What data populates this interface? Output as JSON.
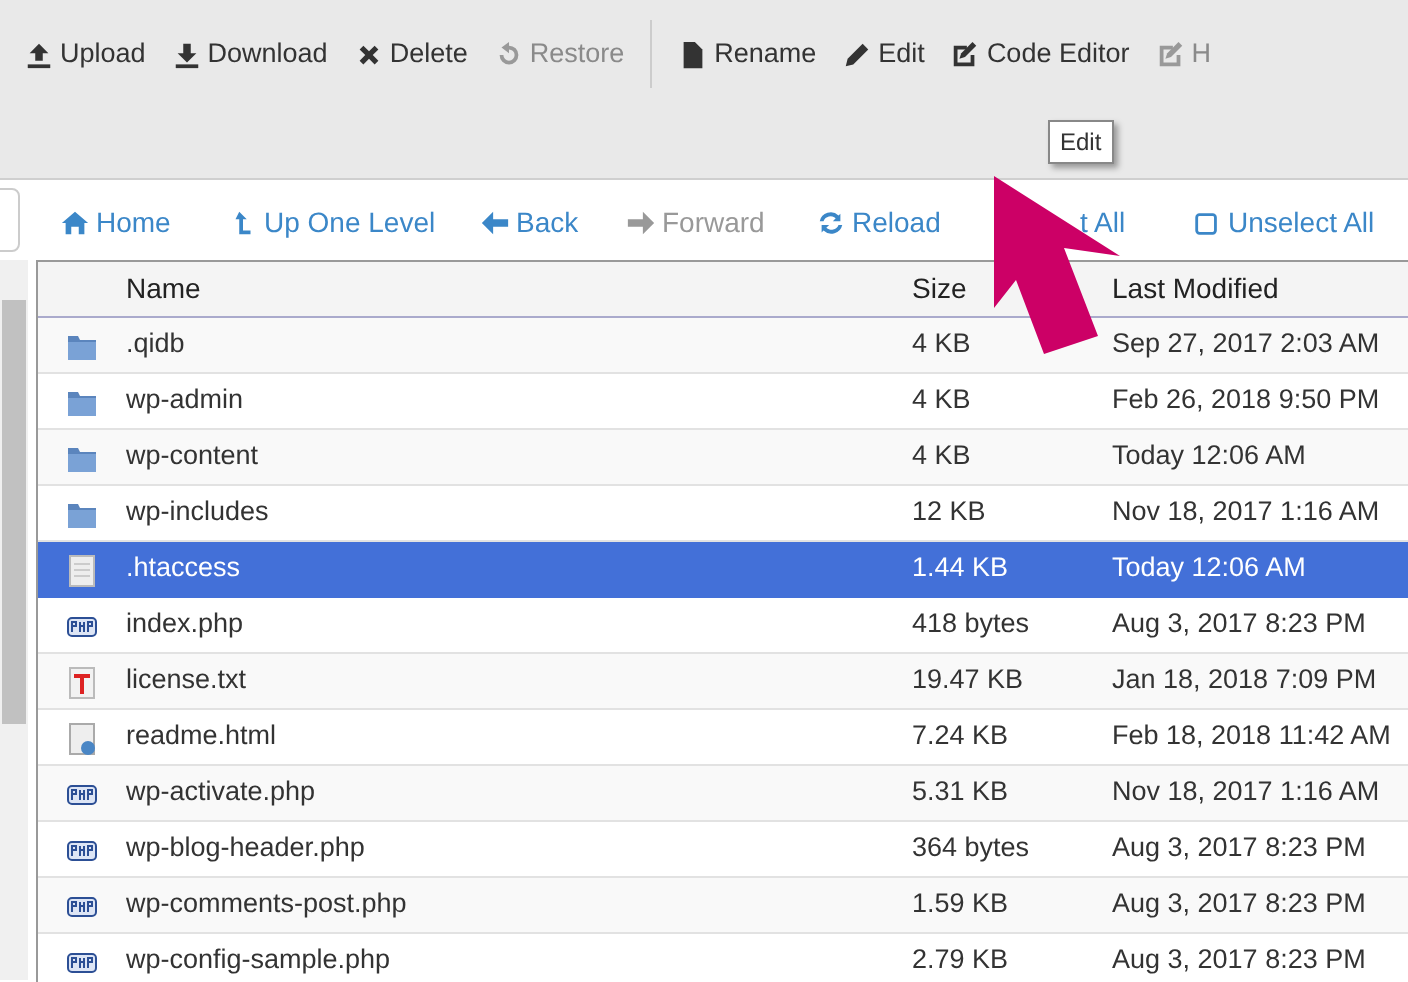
{
  "toolbar": [
    {
      "kind": "upload",
      "label": "Upload",
      "disabled": false
    },
    {
      "kind": "download",
      "label": "Download",
      "disabled": false
    },
    {
      "kind": "delete",
      "label": "Delete",
      "disabled": false
    },
    {
      "kind": "restore",
      "label": "Restore",
      "disabled": true
    },
    {
      "kind": "separator"
    },
    {
      "kind": "rename",
      "label": "Rename",
      "disabled": false
    },
    {
      "kind": "edit",
      "label": "Edit",
      "disabled": false
    },
    {
      "kind": "code",
      "label": "Code Editor",
      "disabled": false
    },
    {
      "kind": "code",
      "label": "H",
      "disabled": true
    }
  ],
  "tooltip": "Edit",
  "nav": [
    {
      "kind": "home",
      "label": "Home",
      "disabled": false
    },
    {
      "kind": "up",
      "label": "Up One Level",
      "disabled": false
    },
    {
      "kind": "back",
      "label": "Back",
      "disabled": false
    },
    {
      "kind": "forward",
      "label": "Forward",
      "disabled": true
    },
    {
      "kind": "reload",
      "label": "Reload",
      "disabled": false
    },
    {
      "kind": "none",
      "label": "t All",
      "disabled": false
    },
    {
      "kind": "square",
      "label": "Unselect All",
      "disabled": false
    }
  ],
  "table": {
    "columns": [
      "Name",
      "Size",
      "Last Modified"
    ],
    "rows": [
      {
        "kind": "folder",
        "name": ".qidb",
        "size": "4 KB",
        "modified": "Sep 27, 2017 2:03 AM",
        "selected": false
      },
      {
        "kind": "folder",
        "name": "wp-admin",
        "size": "4 KB",
        "modified": "Feb 26, 2018 9:50 PM",
        "selected": false
      },
      {
        "kind": "folder",
        "name": "wp-content",
        "size": "4 KB",
        "modified": "Today 12:06 AM",
        "selected": false
      },
      {
        "kind": "folder",
        "name": "wp-includes",
        "size": "12 KB",
        "modified": "Nov 18, 2017 1:16 AM",
        "selected": false
      },
      {
        "kind": "file",
        "name": ".htaccess",
        "size": "1.44 KB",
        "modified": "Today 12:06 AM",
        "selected": true
      },
      {
        "kind": "php",
        "name": "index.php",
        "size": "418 bytes",
        "modified": "Aug 3, 2017 8:23 PM",
        "selected": false
      },
      {
        "kind": "text",
        "name": "license.txt",
        "size": "19.47 KB",
        "modified": "Jan 18, 2018 7:09 PM",
        "selected": false
      },
      {
        "kind": "html",
        "name": "readme.html",
        "size": "7.24 KB",
        "modified": "Feb 18, 2018 11:42 AM",
        "selected": false
      },
      {
        "kind": "php",
        "name": "wp-activate.php",
        "size": "5.31 KB",
        "modified": "Nov 18, 2017 1:16 AM",
        "selected": false
      },
      {
        "kind": "php",
        "name": "wp-blog-header.php",
        "size": "364 bytes",
        "modified": "Aug 3, 2017 8:23 PM",
        "selected": false
      },
      {
        "kind": "php",
        "name": "wp-comments-post.php",
        "size": "1.59 KB",
        "modified": "Aug 3, 2017 8:23 PM",
        "selected": false
      },
      {
        "kind": "php",
        "name": "wp-config-sample.php",
        "size": "2.79 KB",
        "modified": "Aug 3, 2017 8:23 PM",
        "selected": false
      }
    ]
  }
}
